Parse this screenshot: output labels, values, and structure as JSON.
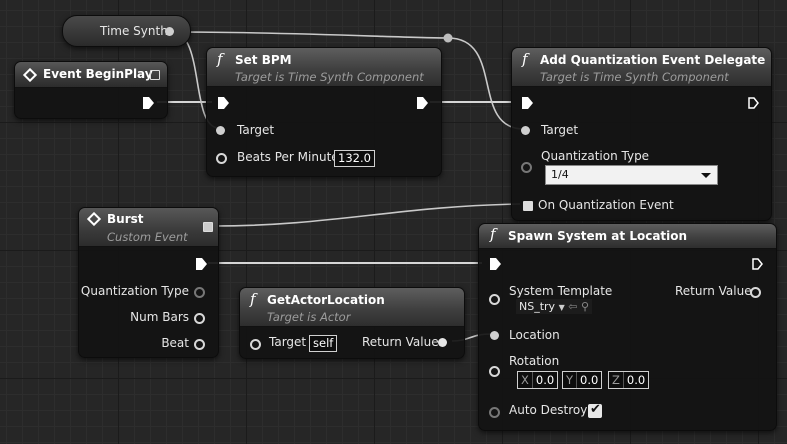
{
  "nodes": {
    "time_synth": {
      "label": "Time Synth"
    },
    "begin_play": {
      "title": "Event BeginPlay"
    },
    "set_bpm": {
      "title": "Set BPM",
      "subtitle": "Target is Time Synth Component",
      "target_label": "Target",
      "bpm_label": "Beats Per Minute",
      "bpm_value": "132.0"
    },
    "add_quant": {
      "title": "Add Quantization Event Delegate",
      "subtitle": "Target is Time Synth Component",
      "target_label": "Target",
      "quant_type_label": "Quantization Type",
      "quant_type_value": "1/4",
      "event_label": "On Quantization Event"
    },
    "burst": {
      "title": "Burst",
      "subtitle": "Custom Event",
      "quant_type_label": "Quantization Type",
      "num_bars_label": "Num Bars",
      "beat_label": "Beat"
    },
    "get_actor_location": {
      "title": "GetActorLocation",
      "subtitle": "Target is Actor",
      "target_label": "Target",
      "target_value": "self",
      "return_label": "Return Value"
    },
    "spawn_system": {
      "title": "Spawn System at Location",
      "system_template_label": "System Template",
      "system_template_value": "NS_try",
      "return_label": "Return Value",
      "location_label": "Location",
      "rotation_label": "Rotation",
      "rot_x_axis": "X",
      "rot_x": "0.0",
      "rot_y_axis": "Y",
      "rot_y": "0.0",
      "rot_z_axis": "Z",
      "rot_z": "0.0",
      "auto_destroy_label": "Auto Destroy",
      "auto_destroy_checked": true
    }
  },
  "icons": {
    "function": "f",
    "event": "diamond-event-icon",
    "exec": "exec-arrow-icon",
    "checkmark": "✔"
  },
  "colors": {
    "wire": "#d8d8d8",
    "node_body": "#121212",
    "header": "#4a4a4a",
    "grid": "#2d2d2d"
  }
}
